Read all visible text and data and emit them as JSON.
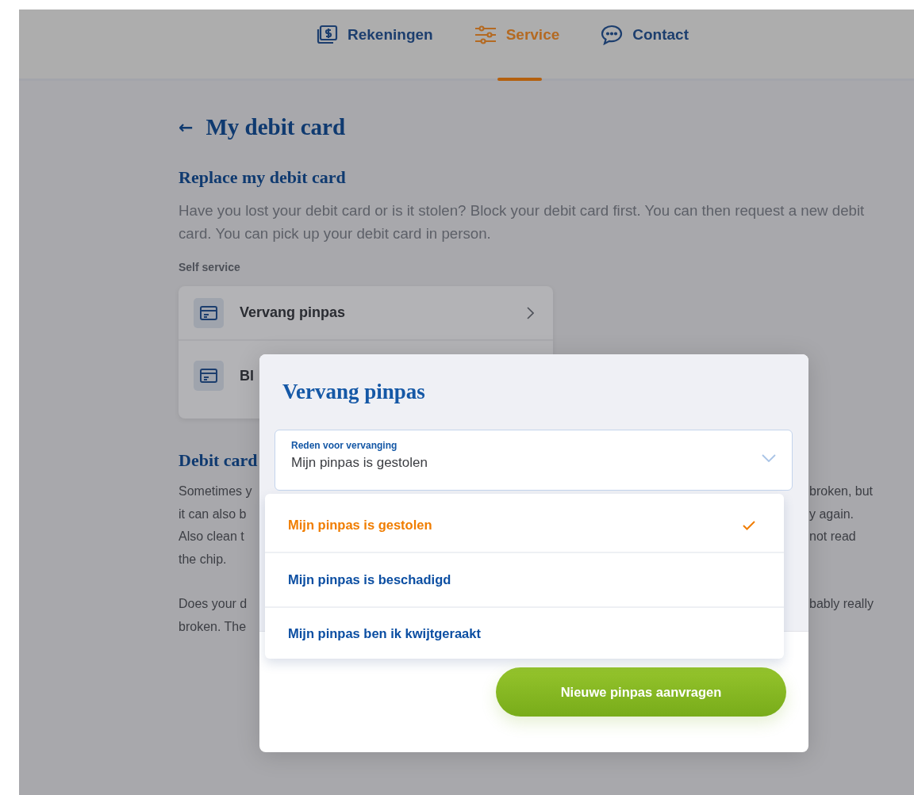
{
  "nav": {
    "tabs": [
      {
        "label": "Rekeningen",
        "selected": false,
        "kind": "money"
      },
      {
        "label": "Service",
        "selected": true,
        "kind": "sliders"
      },
      {
        "label": "Contact",
        "selected": false,
        "kind": "chat"
      }
    ]
  },
  "page": {
    "back_arrow": "←",
    "back_title": "My debit card",
    "section_title": "Replace my debit card",
    "intro": "Have you lost your debit card or is it stolen? Block your debit card first. You can then request a new debit card. You can pick up your debit card in person.",
    "self_service_label": "Self service",
    "self_service_items": [
      "Vervang pinpas",
      "Bl"
    ],
    "section_2_title": "Debit card",
    "section_2_paragraphs": [
      [
        {
          "left": "Sometimes y",
          "right": "broken, but"
        },
        {
          "left": "it can also b",
          "right": "y again."
        },
        {
          "left": "Also clean t",
          "right": "not read"
        },
        {
          "left": "the chip."
        }
      ],
      [
        {
          "left": "Does your d",
          "right": "bably really"
        },
        {
          "left": "broken. The"
        }
      ]
    ]
  },
  "modal": {
    "title": "Vervang pinpas",
    "select": {
      "label": "Reden voor vervanging",
      "value": "Mijn pinpas is gestolen",
      "expanded": true
    },
    "options": [
      {
        "label": "Mijn pinpas is gestolen",
        "selected": true
      },
      {
        "label": "Mijn pinpas is beschadigd",
        "selected": false
      },
      {
        "label": "Mijn pinpas ben ik kwijtgeraakt",
        "selected": false
      }
    ],
    "button": "Nieuwe pinpas aanvragen"
  }
}
